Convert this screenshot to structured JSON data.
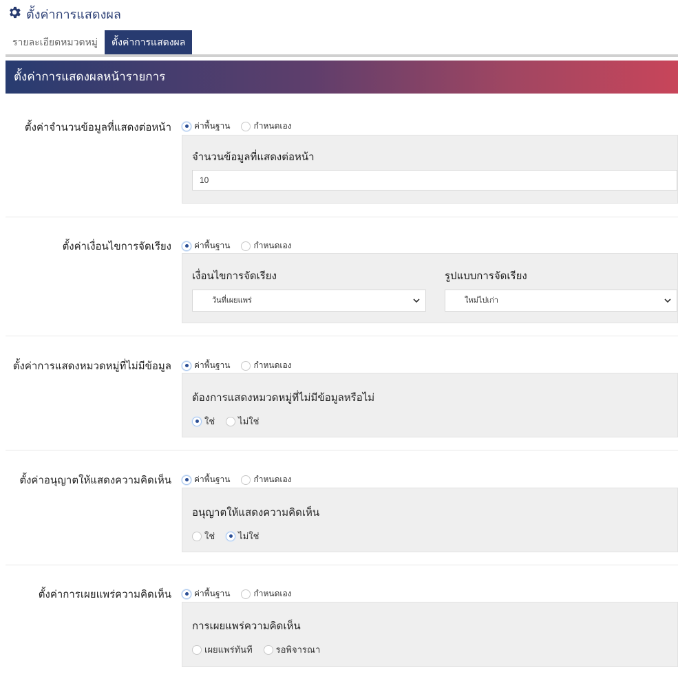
{
  "header": {
    "title": "ตั้งค่าการแสดงผล",
    "icon": "gear-icon",
    "accent": "#283b70"
  },
  "tabs": [
    {
      "label": "รายละเอียดหมวดหมู่",
      "active": false
    },
    {
      "label": "ตั้งค่าการแสดงผล",
      "active": true
    }
  ],
  "banner": {
    "title": "ตั้งค่าการแสดงผลหน้ารายการ"
  },
  "mode_options": {
    "default": "ค่าพื้นฐาน",
    "custom": "กำหนดเอง"
  },
  "sections": {
    "items_per_page": {
      "label": "ตั้งค่าจำนวนข้อมูลที่แสดงต่อหน้า",
      "mode": "default",
      "field_label": "จำนวนข้อมูลที่แสดงต่อหน้า",
      "value": "10"
    },
    "sort": {
      "label": "ตั้งค่าเงื่อนไขการจัดเรียง",
      "mode": "default",
      "condition_label": "เงื่อนไขการจัดเรียง",
      "condition_value": "วันที่เผยแพร่",
      "order_label": "รูปแบบการจัดเรียง",
      "order_value": "ใหม่ไปเก่า"
    },
    "empty_category": {
      "label": "ตั้งค่าการแสดงหมวดหมู่ที่ไม่มีข้อมูล",
      "mode": "default",
      "question": "ต้องการแสดงหมวดหมู่ที่ไม่มีข้อมูลหรือไม่",
      "options": [
        "ใช่",
        "ไม่ใช่"
      ],
      "selected": "ใช่"
    },
    "allow_comments": {
      "label": "ตั้งค่าอนุญาตให้แสดงความคิดเห็น",
      "mode": "default",
      "question": "อนุญาตให้แสดงความคิดเห็น",
      "options": [
        "ใช่",
        "ไม่ใช่"
      ],
      "selected": "ไม่ใช่"
    },
    "publish_comments": {
      "label": "ตั้งค่าการเผยแพร่ความคิดเห็น",
      "mode": "default",
      "question": "การเผยแพร่ความคิดเห็น",
      "options": [
        "เผยแพร่ทันที",
        "รอพิจารณา"
      ],
      "selected": ""
    }
  }
}
